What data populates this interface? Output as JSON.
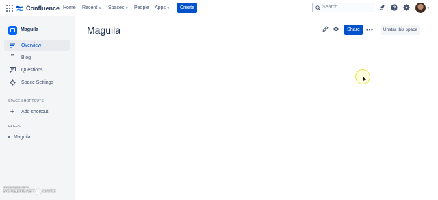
{
  "topnav": {
    "brand": "Confluence",
    "items": [
      {
        "label": "Home",
        "caret": false
      },
      {
        "label": "Recent",
        "caret": true
      },
      {
        "label": "Spaces",
        "caret": true
      },
      {
        "label": "People",
        "caret": false
      },
      {
        "label": "Apps",
        "caret": true
      }
    ],
    "create_label": "Create",
    "search_placeholder": "Search",
    "icons": [
      "notifications-rocket-icon",
      "help-icon",
      "settings-icon"
    ],
    "brand_color": "#0052cc"
  },
  "sidebar": {
    "space_name": "Maguila",
    "items": [
      {
        "label": "Overview",
        "icon": "overview-icon",
        "active": true
      },
      {
        "label": "Blog",
        "icon": "quote-icon",
        "active": false
      },
      {
        "label": "Questions",
        "icon": "chat-icon",
        "active": false
      },
      {
        "label": "Space Settings",
        "icon": "gear-icon",
        "active": false
      }
    ],
    "shortcuts_heading": "SPACE SHORTCUTS",
    "add_shortcut_label": "Add shortcut",
    "pages_heading": "PAGES",
    "pages": [
      "Maguila!"
    ]
  },
  "main": {
    "title": "Maguila",
    "share_label": "Share",
    "unstar_label": "Unstar this space"
  },
  "watermark": {
    "line1": "RECORDED WITH",
    "line2a": "SCREENCAST",
    "line2b": "MATIC"
  }
}
